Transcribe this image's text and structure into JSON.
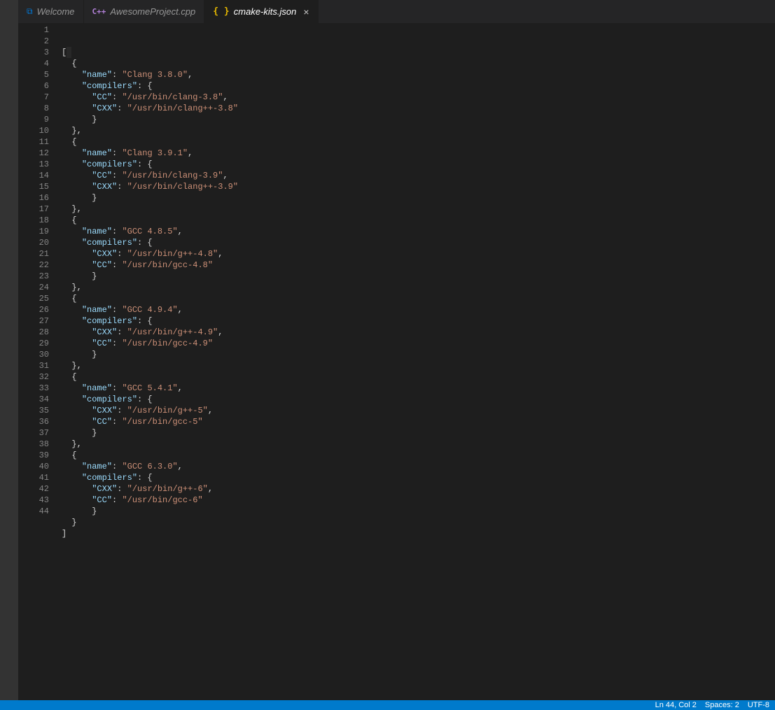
{
  "tabs": [
    {
      "label": "Welcome",
      "icon": "vs"
    },
    {
      "label": "AwesomeProject.cpp",
      "icon": "cpp"
    },
    {
      "label": "cmake-kits.json",
      "icon": "json",
      "active": true,
      "close": "×"
    }
  ],
  "line_count": 44,
  "code_tokens": [
    [
      [
        "punct",
        "["
      ],
      [
        "cur",
        " "
      ]
    ],
    [
      [
        "ig",
        "  "
      ],
      [
        "punct",
        "{"
      ]
    ],
    [
      [
        "ig",
        "    "
      ],
      [
        "key",
        "\"name\""
      ],
      [
        "punct",
        ": "
      ],
      [
        "str",
        "\"Clang 3.8.0\""
      ],
      [
        "punct",
        ","
      ]
    ],
    [
      [
        "ig",
        "    "
      ],
      [
        "key",
        "\"compilers\""
      ],
      [
        "punct",
        ": {"
      ]
    ],
    [
      [
        "ig",
        "      "
      ],
      [
        "key",
        "\"CC\""
      ],
      [
        "punct",
        ": "
      ],
      [
        "str",
        "\"/usr/bin/clang-3.8\""
      ],
      [
        "punct",
        ","
      ]
    ],
    [
      [
        "ig",
        "      "
      ],
      [
        "key",
        "\"CXX\""
      ],
      [
        "punct",
        ": "
      ],
      [
        "str",
        "\"/usr/bin/clang++-3.8\""
      ]
    ],
    [
      [
        "ig",
        "      "
      ],
      [
        "punct",
        "}"
      ]
    ],
    [
      [
        "ig",
        "  "
      ],
      [
        "punct",
        "},"
      ]
    ],
    [
      [
        "ig",
        "  "
      ],
      [
        "punct",
        "{"
      ]
    ],
    [
      [
        "ig",
        "    "
      ],
      [
        "key",
        "\"name\""
      ],
      [
        "punct",
        ": "
      ],
      [
        "str",
        "\"Clang 3.9.1\""
      ],
      [
        "punct",
        ","
      ]
    ],
    [
      [
        "ig",
        "    "
      ],
      [
        "key",
        "\"compilers\""
      ],
      [
        "punct",
        ": {"
      ]
    ],
    [
      [
        "ig",
        "      "
      ],
      [
        "key",
        "\"CC\""
      ],
      [
        "punct",
        ": "
      ],
      [
        "str",
        "\"/usr/bin/clang-3.9\""
      ],
      [
        "punct",
        ","
      ]
    ],
    [
      [
        "ig",
        "      "
      ],
      [
        "key",
        "\"CXX\""
      ],
      [
        "punct",
        ": "
      ],
      [
        "str",
        "\"/usr/bin/clang++-3.9\""
      ]
    ],
    [
      [
        "ig",
        "      "
      ],
      [
        "punct",
        "}"
      ]
    ],
    [
      [
        "ig",
        "  "
      ],
      [
        "punct",
        "},"
      ]
    ],
    [
      [
        "ig",
        "  "
      ],
      [
        "punct",
        "{"
      ]
    ],
    [
      [
        "ig",
        "    "
      ],
      [
        "key",
        "\"name\""
      ],
      [
        "punct",
        ": "
      ],
      [
        "str",
        "\"GCC 4.8.5\""
      ],
      [
        "punct",
        ","
      ]
    ],
    [
      [
        "ig",
        "    "
      ],
      [
        "key",
        "\"compilers\""
      ],
      [
        "punct",
        ": {"
      ]
    ],
    [
      [
        "ig",
        "      "
      ],
      [
        "key",
        "\"CXX\""
      ],
      [
        "punct",
        ": "
      ],
      [
        "str",
        "\"/usr/bin/g++-4.8\""
      ],
      [
        "punct",
        ","
      ]
    ],
    [
      [
        "ig",
        "      "
      ],
      [
        "key",
        "\"CC\""
      ],
      [
        "punct",
        ": "
      ],
      [
        "str",
        "\"/usr/bin/gcc-4.8\""
      ]
    ],
    [
      [
        "ig",
        "      "
      ],
      [
        "punct",
        "}"
      ]
    ],
    [
      [
        "ig",
        "  "
      ],
      [
        "punct",
        "},"
      ]
    ],
    [
      [
        "ig",
        "  "
      ],
      [
        "punct",
        "{"
      ]
    ],
    [
      [
        "ig",
        "    "
      ],
      [
        "key",
        "\"name\""
      ],
      [
        "punct",
        ": "
      ],
      [
        "str",
        "\"GCC 4.9.4\""
      ],
      [
        "punct",
        ","
      ]
    ],
    [
      [
        "ig",
        "    "
      ],
      [
        "key",
        "\"compilers\""
      ],
      [
        "punct",
        ": {"
      ]
    ],
    [
      [
        "ig",
        "      "
      ],
      [
        "key",
        "\"CXX\""
      ],
      [
        "punct",
        ": "
      ],
      [
        "str",
        "\"/usr/bin/g++-4.9\""
      ],
      [
        "punct",
        ","
      ]
    ],
    [
      [
        "ig",
        "      "
      ],
      [
        "key",
        "\"CC\""
      ],
      [
        "punct",
        ": "
      ],
      [
        "str",
        "\"/usr/bin/gcc-4.9\""
      ]
    ],
    [
      [
        "ig",
        "      "
      ],
      [
        "punct",
        "}"
      ]
    ],
    [
      [
        "ig",
        "  "
      ],
      [
        "punct",
        "},"
      ]
    ],
    [
      [
        "ig",
        "  "
      ],
      [
        "punct",
        "{"
      ]
    ],
    [
      [
        "ig",
        "    "
      ],
      [
        "key",
        "\"name\""
      ],
      [
        "punct",
        ": "
      ],
      [
        "str",
        "\"GCC 5.4.1\""
      ],
      [
        "punct",
        ","
      ]
    ],
    [
      [
        "ig",
        "    "
      ],
      [
        "key",
        "\"compilers\""
      ],
      [
        "punct",
        ": {"
      ]
    ],
    [
      [
        "ig",
        "      "
      ],
      [
        "key",
        "\"CXX\""
      ],
      [
        "punct",
        ": "
      ],
      [
        "str",
        "\"/usr/bin/g++-5\""
      ],
      [
        "punct",
        ","
      ]
    ],
    [
      [
        "ig",
        "      "
      ],
      [
        "key",
        "\"CC\""
      ],
      [
        "punct",
        ": "
      ],
      [
        "str",
        "\"/usr/bin/gcc-5\""
      ]
    ],
    [
      [
        "ig",
        "      "
      ],
      [
        "punct",
        "}"
      ]
    ],
    [
      [
        "ig",
        "  "
      ],
      [
        "punct",
        "},"
      ]
    ],
    [
      [
        "ig",
        "  "
      ],
      [
        "punct",
        "{"
      ]
    ],
    [
      [
        "ig",
        "    "
      ],
      [
        "key",
        "\"name\""
      ],
      [
        "punct",
        ": "
      ],
      [
        "str",
        "\"GCC 6.3.0\""
      ],
      [
        "punct",
        ","
      ]
    ],
    [
      [
        "ig",
        "    "
      ],
      [
        "key",
        "\"compilers\""
      ],
      [
        "punct",
        ": {"
      ]
    ],
    [
      [
        "ig",
        "      "
      ],
      [
        "key",
        "\"CXX\""
      ],
      [
        "punct",
        ": "
      ],
      [
        "str",
        "\"/usr/bin/g++-6\""
      ],
      [
        "punct",
        ","
      ]
    ],
    [
      [
        "ig",
        "      "
      ],
      [
        "key",
        "\"CC\""
      ],
      [
        "punct",
        ": "
      ],
      [
        "str",
        "\"/usr/bin/gcc-6\""
      ]
    ],
    [
      [
        "ig",
        "      "
      ],
      [
        "punct",
        "}"
      ]
    ],
    [
      [
        "ig",
        "  "
      ],
      [
        "punct",
        "}"
      ]
    ],
    [
      [
        "punct",
        "]"
      ]
    ]
  ],
  "status": {
    "cursor": "Ln 44, Col 2",
    "spaces": "Spaces: 2",
    "encoding": "UTF-8"
  }
}
